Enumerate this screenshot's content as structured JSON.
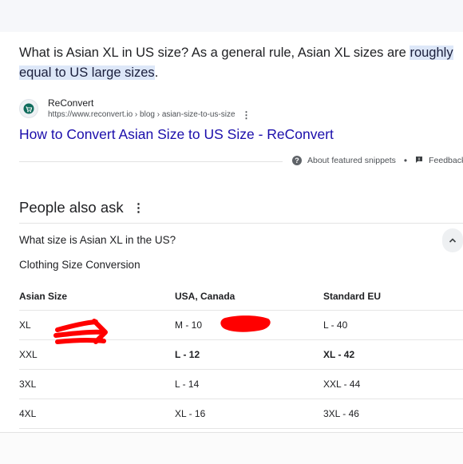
{
  "snippet": {
    "text_plain": "What is Asian XL in US size? As a general rule, Asian XL sizes are ",
    "text_highlight": "roughly equal to US large sizes",
    "text_end": "."
  },
  "source": {
    "name": "ReConvert",
    "url": "https://www.reconvert.io › blog › asian-size-to-us-size",
    "title": "How to Convert Asian Size to US Size - ReConvert",
    "icon": "reconvert-logo-icon"
  },
  "snippet_footer": {
    "about_label": "About featured snippets",
    "separator": "•",
    "feedback_label": "Feedback"
  },
  "paa": {
    "title": "People also ask",
    "question": "What size is Asian XL in the US?",
    "answer_title": "Clothing Size Conversion",
    "table": {
      "headers": [
        "Asian Size",
        "USA, Canada",
        "Standard EU"
      ],
      "rows": [
        [
          "XL",
          "M - 10",
          "L - 40"
        ],
        [
          "XXL",
          "L - 12",
          "XL - 42"
        ],
        [
          "3XL",
          "L - 14",
          "XXL - 44"
        ],
        [
          "4XL",
          "XL - 16",
          "3XL - 46"
        ]
      ]
    }
  },
  "colors": {
    "link": "#1a0dab",
    "highlight": "#dde7f8",
    "annotation_red": "#ff0000"
  }
}
